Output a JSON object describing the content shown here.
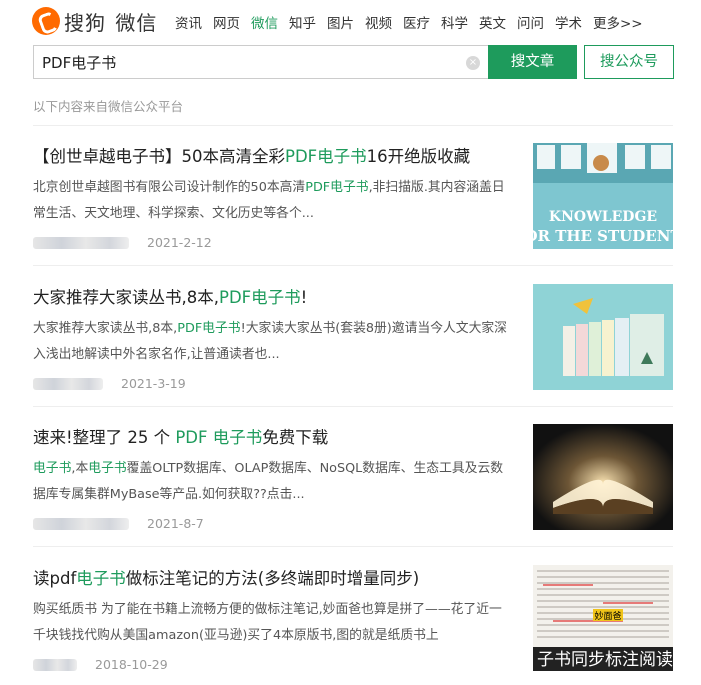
{
  "header": {
    "logo_text": "搜狗",
    "logo_sub": "微信",
    "nav": [
      {
        "label": "资讯",
        "active": false
      },
      {
        "label": "网页",
        "active": false
      },
      {
        "label": "微信",
        "active": true
      },
      {
        "label": "知乎",
        "active": false
      },
      {
        "label": "图片",
        "active": false
      },
      {
        "label": "视频",
        "active": false
      },
      {
        "label": "医疗",
        "active": false
      },
      {
        "label": "科学",
        "active": false
      },
      {
        "label": "英文",
        "active": false
      },
      {
        "label": "问问",
        "active": false
      },
      {
        "label": "学术",
        "active": false
      },
      {
        "label": "更多>>",
        "active": false
      }
    ]
  },
  "search": {
    "value": "PDF电子书",
    "clear_icon": "×",
    "article_button": "搜文章",
    "account_button": "搜公众号"
  },
  "source_note": "以下内容来自微信公众平台",
  "colors": {
    "accent": "#1e9b5c",
    "brand_orange": "#ff6a00"
  },
  "results": [
    {
      "title_pre": "【创世卓越电子书】50本高清全彩",
      "title_hl": "PDF电子书",
      "title_post": "16开绝版收藏",
      "snippet_pre": "北京创世卓越图书有限公司设计制作的50本高清",
      "snippet_hl": "PDF电子书",
      "snippet_post": ",非扫描版.其内容涵盖日常生活、天文地理、科学探索、文化历史等各个...",
      "date": "2021-2-12",
      "thumb": "knowledge-books"
    },
    {
      "title_pre": "大家推荐大家读丛书,8本,",
      "title_hl": "PDF电子书",
      "title_post": "!",
      "snippet_pre": "大家推荐大家读丛书,8本,",
      "snippet_hl": "PDF电子书",
      "snippet_post": "!大家读大家丛书(套装8册)邀请当今人文大家深入浅出地解读中外名家名作,让普通读者也...",
      "date": "2021-3-19",
      "thumb": "book-set"
    },
    {
      "title_pre": "速来!整理了 25 个 ",
      "title_hl": "PDF 电子书",
      "title_post": "免费下载",
      "snippet_pre": "",
      "snippet_hl": "电子书",
      "snippet_mid": ",本",
      "snippet_hl2": "电子书",
      "snippet_post": "覆盖OLTP数据库、OLAP数据库、NoSQL数据库、生态工具及云数据库专属集群MyBase等产品.如何获取??点击...",
      "date": "2021-8-7",
      "thumb": "open-book"
    },
    {
      "title_pre": "读pdf",
      "title_hl": "电子书",
      "title_post": "做标注笔记的方法(多终端即时增量同步)",
      "snippet_pre": "购买纸质书 为了能在书籍上流畅方便的做标注笔记,妙面爸也算是拼了——花了近一千块钱找代购从美国amazon(亚马逊)买了4本原版书,图的就是纸质书上",
      "date": "2018-10-29",
      "thumb": "annotated-page",
      "thumb_banner": "子书同步标注阅读",
      "thumb_badge": "妙面爸"
    }
  ]
}
